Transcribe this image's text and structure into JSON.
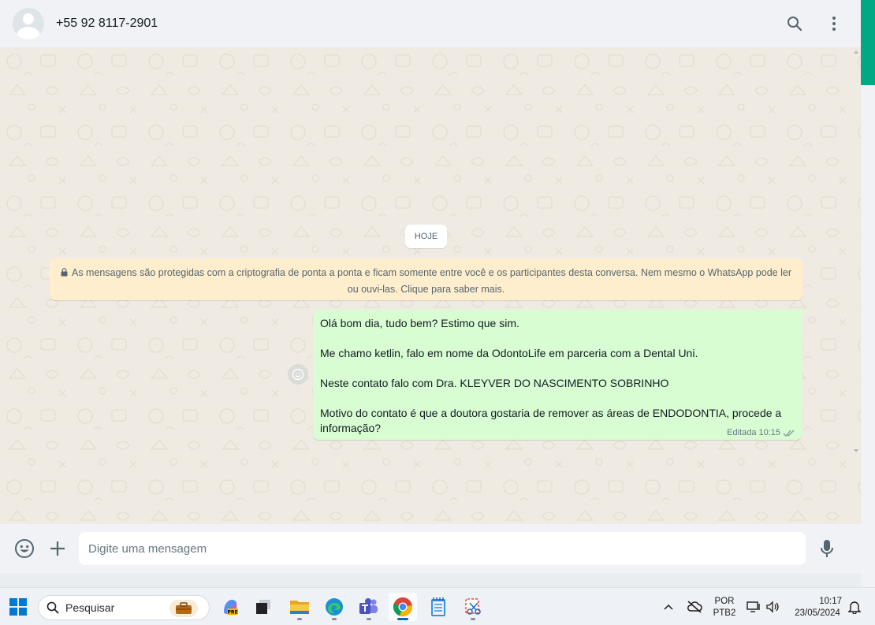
{
  "header": {
    "contact_name": "+55 92 8117-2901",
    "icons": [
      "avatar",
      "search-icon",
      "menu-icon"
    ]
  },
  "chat": {
    "date_chip": "HOJE",
    "encryption_notice": {
      "line1": "As mensagens são protegidas com a criptografia de ponta a ponta e ficam somente entre você e os participantes desta conversa. Nem mesmo o WhatsApp pode ler",
      "line2": "ou ouvi-las. Clique para saber mais."
    },
    "message": {
      "lines": [
        "Olá bom dia, tudo bem? Estimo que sim.",
        "Me chamo ketlin, falo em nome da OdontoLife em parceria com a Dental Uni.",
        "Neste contato falo com Dra. KLEYVER DO NASCIMENTO SOBRINHO",
        "Motivo do contato é que a doutora gostaria de remover as áreas de ENDODONTIA,  procede a",
        "informação?"
      ],
      "status": "Editada",
      "time": "10:15"
    }
  },
  "composer": {
    "placeholder": "Digite uma mensagem",
    "icons": [
      "emoji-icon",
      "plus-icon",
      "microphone-icon"
    ]
  },
  "taskbar": {
    "search_label": "Pesquisar",
    "apps": [
      "windows-start",
      "copilot",
      "task-view",
      "file-explorer",
      "edge",
      "teams",
      "chrome",
      "notepad",
      "snipping-tool"
    ],
    "active_app": "chrome",
    "tray": {
      "language_line1": "POR",
      "language_line2": "PTB2",
      "time": "10:17",
      "date": "23/05/2024"
    }
  },
  "colors": {
    "accent": "#00a884",
    "bubble_out": "#d9fdd3",
    "notice_bg": "#ffeecd",
    "chat_bg": "#efeae2",
    "read_ticks": "#8696a0"
  }
}
